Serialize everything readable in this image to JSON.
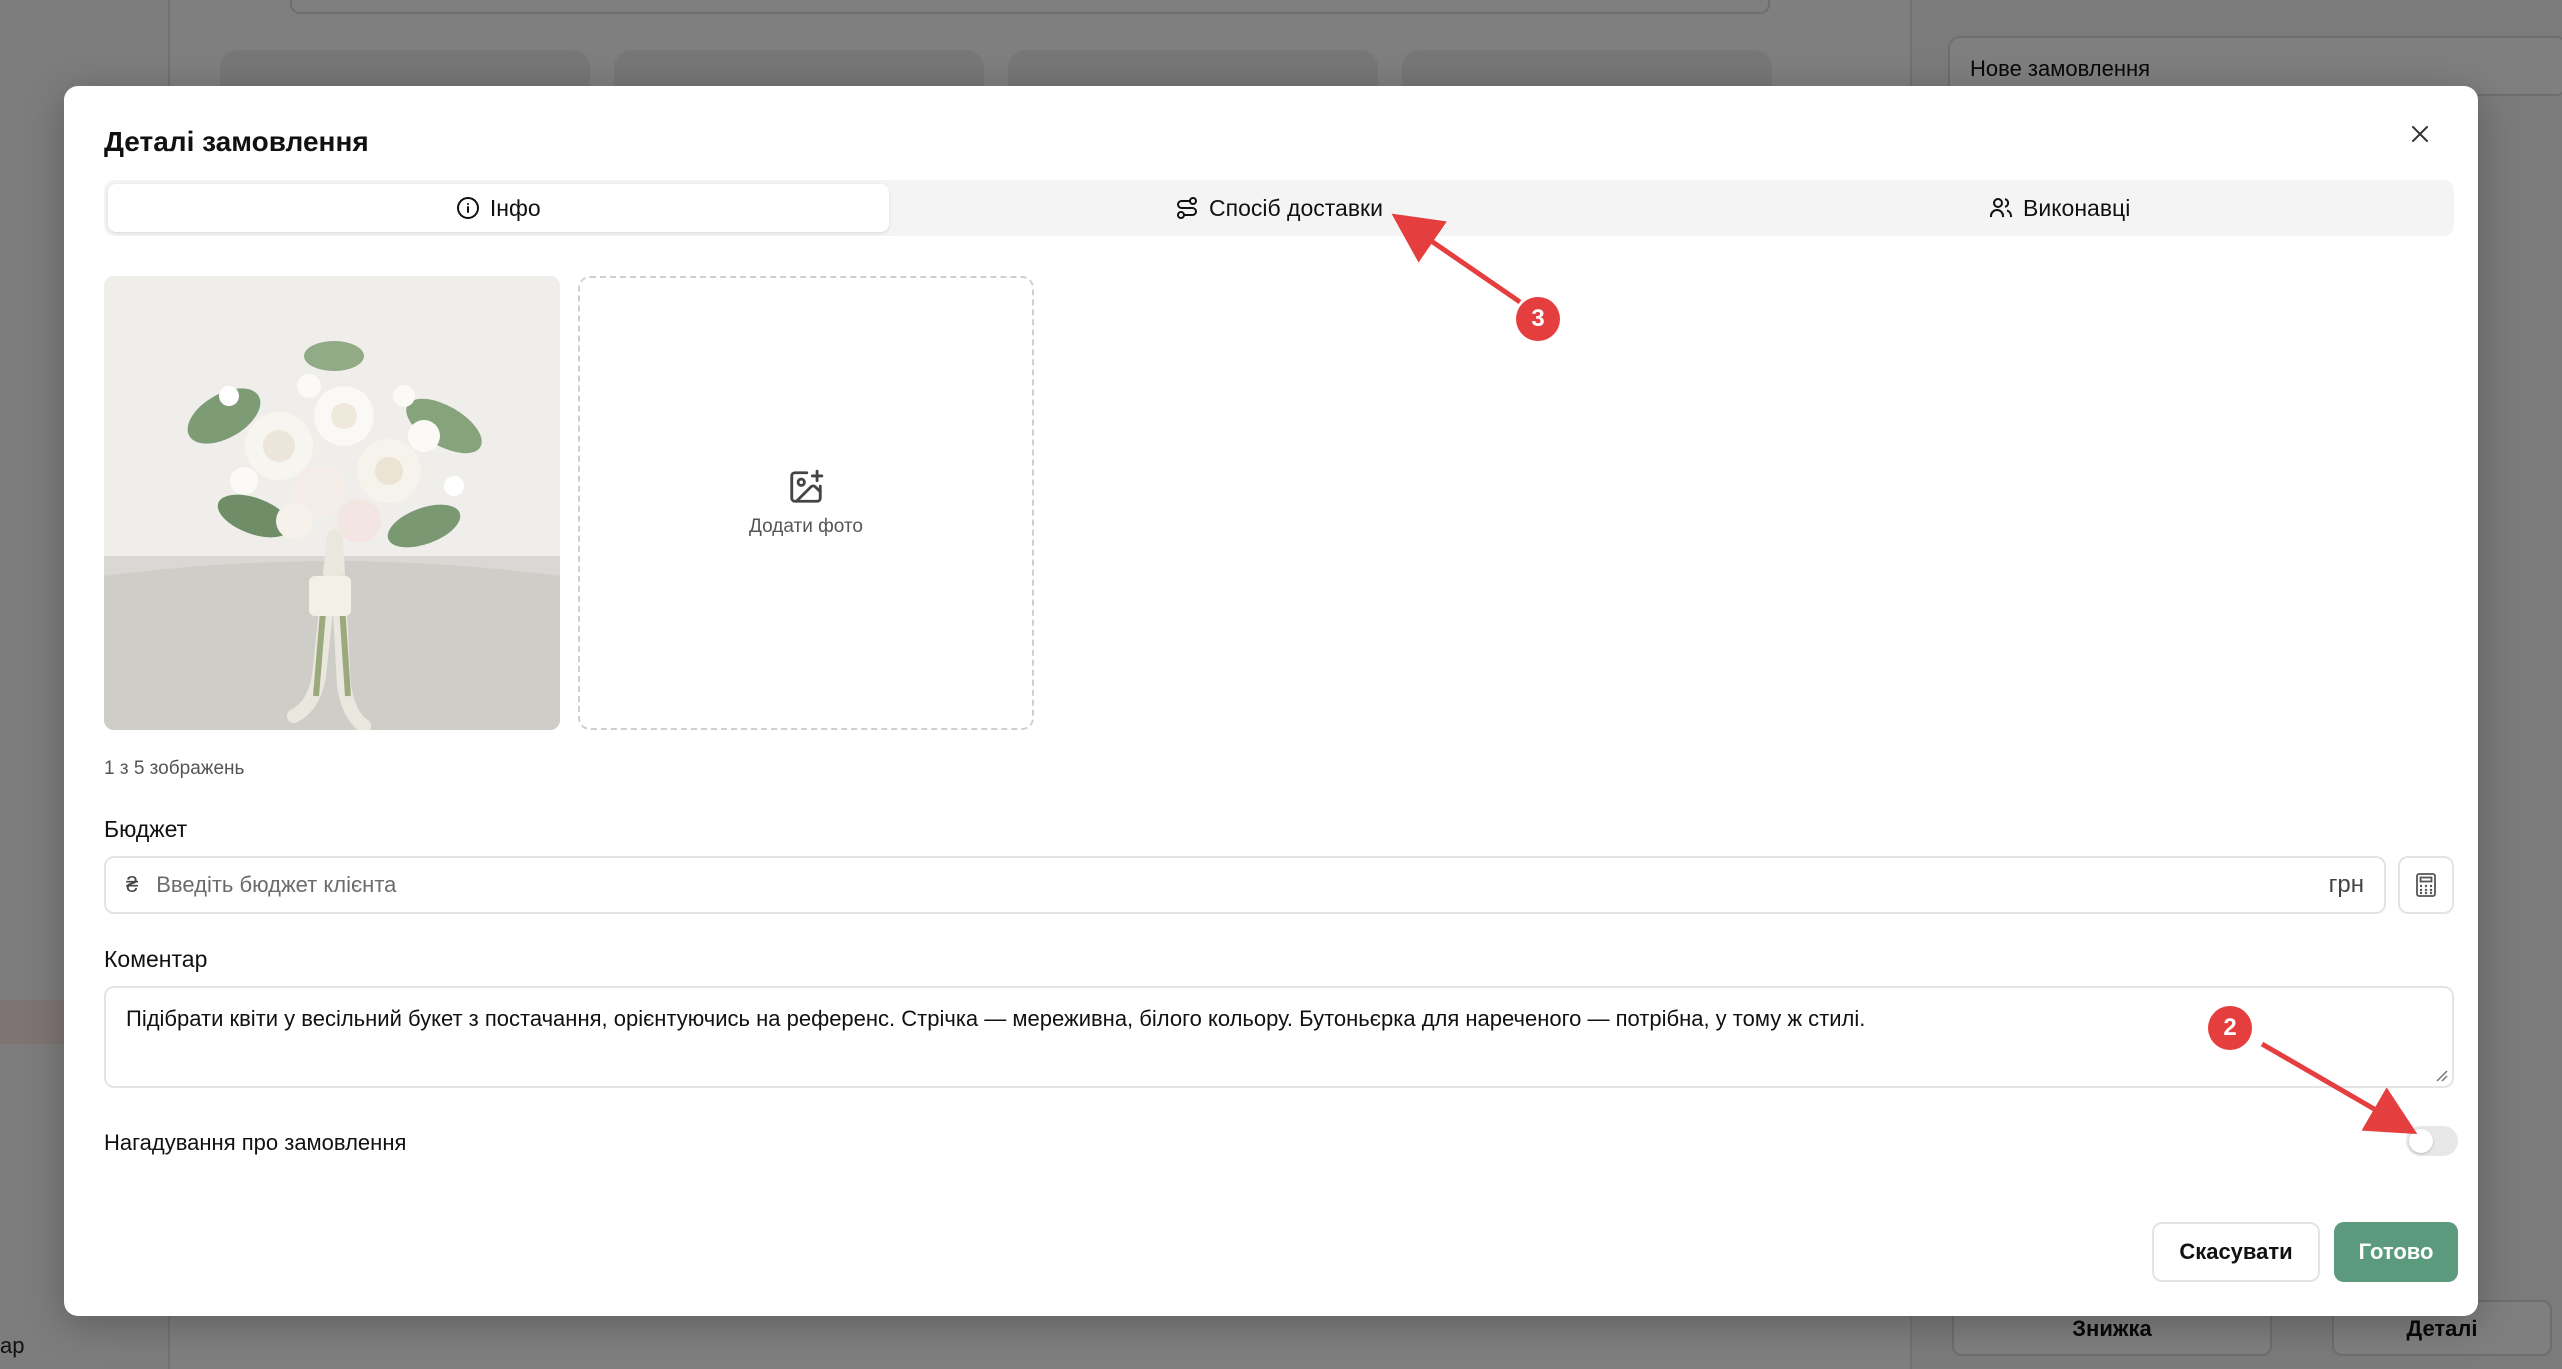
{
  "background": {
    "order_panel_title": "Нове замовлення",
    "discount_button": "Знижка",
    "details_button": "Деталі",
    "sidebar_bottom_text": "ар"
  },
  "modal": {
    "title": "Деталі замовлення",
    "tabs": [
      {
        "label": "Інфо",
        "icon": "info-icon",
        "active": true
      },
      {
        "label": "Спосіб доставки",
        "icon": "route-icon",
        "active": false
      },
      {
        "label": "Виконавці",
        "icon": "users-icon",
        "active": false
      }
    ],
    "add_photo_label": "Додати фото",
    "image_count": "1 з 5 зображень",
    "budget": {
      "label": "Бюджет",
      "currency_sign": "₴",
      "placeholder": "Введіть бюджет клієнта",
      "unit": "грн"
    },
    "comment": {
      "label": "Коментар",
      "value": "Підібрати квіти у весільний букет з постачання, орієнтуючись на референс. Стрічка — мереживна, білого кольору. Бутоньєрка для нареченого — потрібна, у тому ж стилі."
    },
    "reminder": {
      "label": "Нагадування про замовлення",
      "enabled": false
    },
    "buttons": {
      "cancel": "Скасувати",
      "done": "Готово"
    }
  },
  "annotations": [
    {
      "number": "3"
    },
    {
      "number": "2"
    }
  ],
  "colors": {
    "primary_button": "#5b9a7c",
    "annotation_red": "#e53e3e"
  }
}
